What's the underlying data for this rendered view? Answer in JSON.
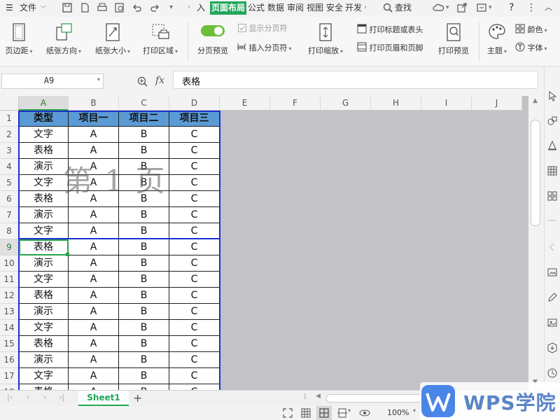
{
  "menubar": {
    "file_label": "文件",
    "tabs": [
      "入",
      "页面布局",
      "公式",
      "数据",
      "审阅",
      "视图",
      "安全",
      "开发"
    ],
    "search_label": "查找"
  },
  "ribbon": {
    "margins": "页边距",
    "orientation": "纸张方向",
    "size": "纸张大小",
    "print_area": "打印区域",
    "page_break_preview": "分页预览",
    "show_page_breaks": "显示分页符",
    "insert_page_break": "插入分页符",
    "print_scale": "打印缩放",
    "print_titles": "打印标题或表头",
    "print_header_footer": "打印页眉和页脚",
    "print_preview": "打印预览",
    "theme": "主题",
    "colors": "颜色",
    "fonts": "字体"
  },
  "formula_bar": {
    "name_box": "A9",
    "fx": "fx",
    "value": "表格"
  },
  "columns": [
    "A",
    "B",
    "C",
    "D",
    "E",
    "F",
    "G",
    "H",
    "I",
    "J"
  ],
  "rows": [
    "1",
    "2",
    "3",
    "4",
    "5",
    "6",
    "7",
    "8",
    "9",
    "10",
    "11",
    "12",
    "13",
    "14",
    "15",
    "16",
    "17",
    "18"
  ],
  "table": {
    "headers": [
      "类型",
      "项目一",
      "项目二",
      "项目三"
    ],
    "data": [
      [
        "文字",
        "A",
        "B",
        "C"
      ],
      [
        "表格",
        "A",
        "B",
        "C"
      ],
      [
        "演示",
        "A",
        "B",
        "C"
      ],
      [
        "文字",
        "A",
        "B",
        "C"
      ],
      [
        "表格",
        "A",
        "B",
        "C"
      ],
      [
        "演示",
        "A",
        "B",
        "C"
      ],
      [
        "文字",
        "A",
        "B",
        "C"
      ],
      [
        "表格",
        "A",
        "B",
        "C"
      ],
      [
        "演示",
        "A",
        "B",
        "C"
      ],
      [
        "文字",
        "A",
        "B",
        "C"
      ],
      [
        "表格",
        "A",
        "B",
        "C"
      ],
      [
        "演示",
        "A",
        "B",
        "C"
      ],
      [
        "文字",
        "A",
        "B",
        "C"
      ],
      [
        "表格",
        "A",
        "B",
        "C"
      ],
      [
        "演示",
        "A",
        "B",
        "C"
      ],
      [
        "文字",
        "A",
        "B",
        "C"
      ],
      [
        "表格",
        "A",
        "B",
        "C"
      ]
    ]
  },
  "page_watermark": "第 1 页",
  "sheet_tab": "Sheet1",
  "status": {
    "zoom": "100%"
  },
  "watermark_logo": "WPS学院",
  "colors": {
    "accent": "#22a65a",
    "header_fill": "#5b9bd5",
    "page_break": "#1a2fd0",
    "nonprint_area": "#c3c2c6"
  }
}
